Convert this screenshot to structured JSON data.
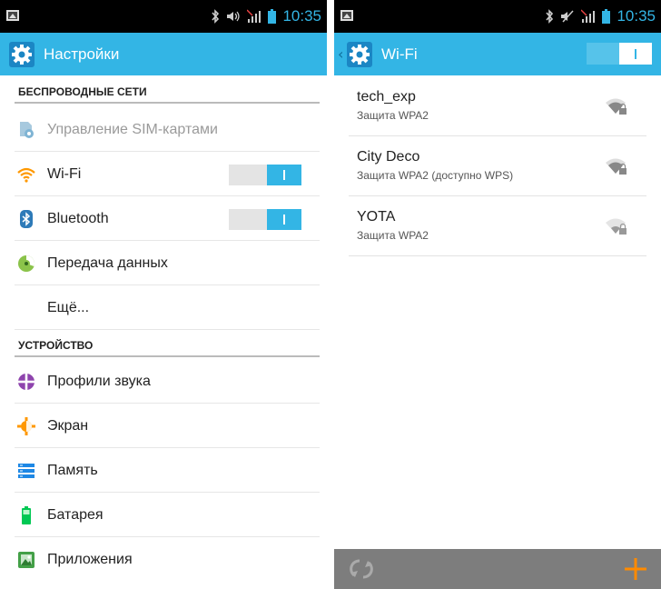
{
  "status_bar": {
    "time": "10:35"
  },
  "settings": {
    "title": "Настройки",
    "sections": {
      "wireless": "БЕСПРОВОДНЫЕ СЕТИ",
      "device": "УСТРОЙСТВО"
    },
    "items": {
      "sim": "Управление SIM-картами",
      "wifi": "Wi-Fi",
      "bluetooth": "Bluetooth",
      "data": "Передача данных",
      "more": "Ещё...",
      "sound": "Профили звука",
      "screen": "Экран",
      "memory": "Память",
      "battery": "Батарея",
      "apps": "Приложения"
    },
    "toggles": {
      "wifi_on": true,
      "bluetooth_on": true
    }
  },
  "wifi": {
    "title": "Wi-Fi",
    "networks": [
      {
        "name": "tech_exp",
        "security": "Защита WPA2",
        "signal_bars": 3
      },
      {
        "name": "City Deco",
        "security": "Защита WPA2 (доступно WPS)",
        "signal_bars": 3
      },
      {
        "name": "YOTA",
        "security": "Защита WPA2",
        "signal_bars": 2
      }
    ]
  },
  "colors": {
    "accent": "#33b5e5",
    "status_bar": "#000000",
    "bottom_bar": "#7d7d7d",
    "add_icon": "#ff8a00",
    "wifi_icon": "#ff9800"
  },
  "icons": [
    "sim-card-icon",
    "wifi-icon",
    "bluetooth-icon",
    "data-usage-icon",
    "sound-profile-icon",
    "display-icon",
    "storage-icon",
    "battery-icon",
    "apps-icon",
    "refresh-icon",
    "add-icon",
    "gear-icon"
  ]
}
